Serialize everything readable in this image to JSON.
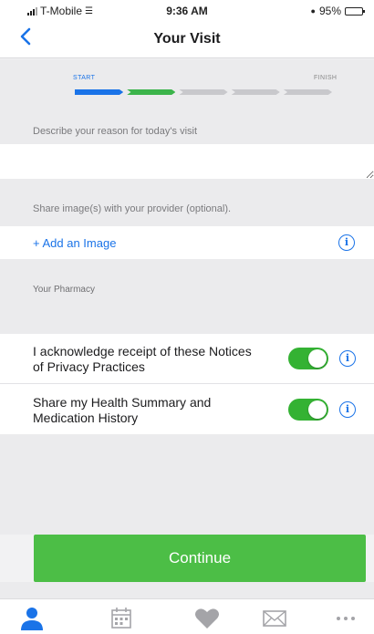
{
  "status_bar": {
    "carrier": "T-Mobile",
    "time": "9:36 AM",
    "battery": "95%",
    "battery_level": 0.95
  },
  "nav": {
    "back_icon": "chevron-left-icon",
    "title": "Your Visit"
  },
  "progress": {
    "start_label": "START",
    "finish_label": "FINISH",
    "segments_total": 5,
    "segments_completed": 2,
    "colors": {
      "completed": [
        "#1a73e8",
        "#3cb44b"
      ],
      "pending": "#c8c8cc"
    }
  },
  "reason": {
    "label": "Describe your reason for today's visit",
    "value": ""
  },
  "images": {
    "label": "Share image(s) with your provider (optional).",
    "add_label": "+ Add an Image",
    "info_icon": "info-icon"
  },
  "pharmacy": {
    "label": "Your Pharmacy"
  },
  "toggles": [
    {
      "label": "I acknowledge receipt of these Notices of Privacy Practices",
      "on": true
    },
    {
      "label": "Share my Health Summary and Medication History",
      "on": true
    }
  ],
  "continue_label": "Continue",
  "tab_bar": {
    "items": [
      {
        "icon": "person-icon",
        "active": true
      },
      {
        "icon": "calendar-icon",
        "active": false
      },
      {
        "icon": "heart-icon",
        "active": false
      },
      {
        "icon": "mail-icon",
        "active": false
      },
      {
        "icon": "more-icon",
        "active": false
      }
    ]
  },
  "colors": {
    "accent_blue": "#1a73e8",
    "toggle_green": "#34b233",
    "button_green": "#4cbe46"
  }
}
